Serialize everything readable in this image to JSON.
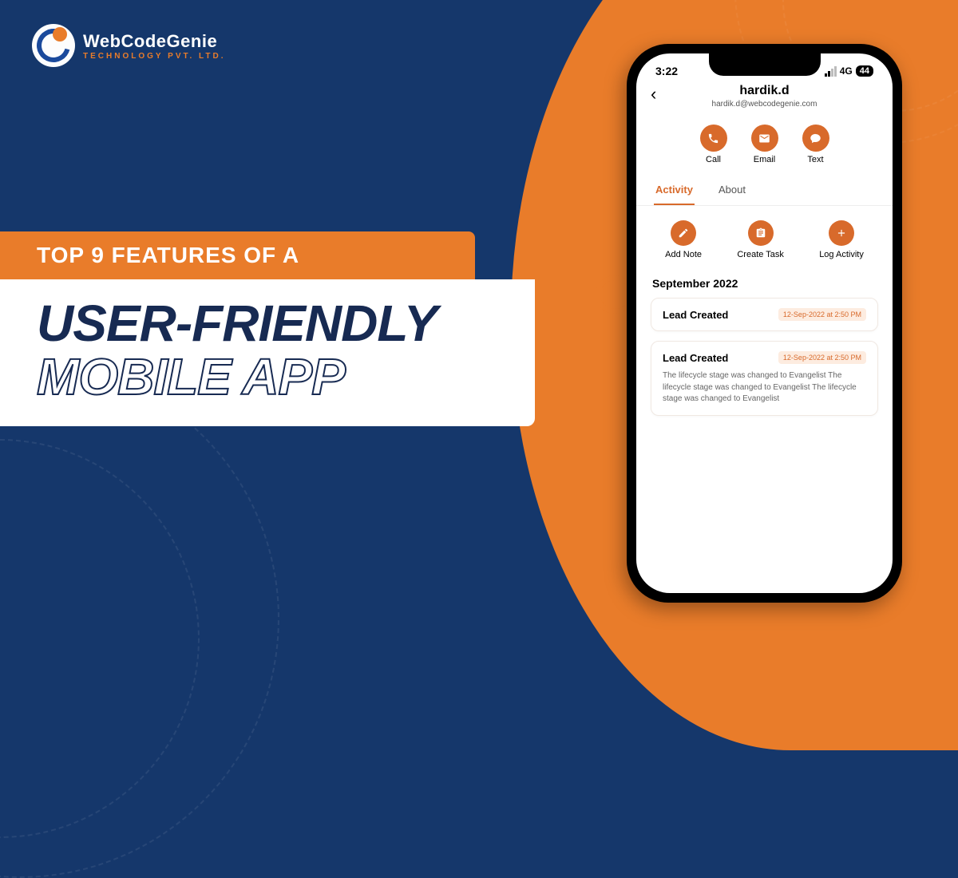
{
  "brand": {
    "name": "WebCodeGenie",
    "tagline": "TECHNOLOGY PVT. LTD."
  },
  "headline": {
    "pre": "TOP 9 FEATURES OF A",
    "line1": "USER-FRIENDLY",
    "line2": "MOBILE APP"
  },
  "phone": {
    "status": {
      "time": "3:22",
      "network": "4G",
      "battery": "44"
    },
    "contact": {
      "name": "hardik.d",
      "email": "hardik.d@webcodegenie.com"
    },
    "actions": {
      "call": "Call",
      "email": "Email",
      "text": "Text"
    },
    "tabs": {
      "activity": "Activity",
      "about": "About"
    },
    "subactions": {
      "note": "Add Note",
      "task": "Create Task",
      "log": "Log Activity"
    },
    "feed": {
      "month": "September 2022",
      "items": [
        {
          "title": "Lead Created",
          "time": "12-Sep-2022 at 2:50 PM",
          "body": ""
        },
        {
          "title": "Lead Created",
          "time": "12-Sep-2022 at 2:50 PM",
          "body": "The lifecycle stage was changed to Evangelist The lifecycle stage was changed to Evangelist The lifecycle stage was changed to Evangelist"
        }
      ]
    }
  }
}
